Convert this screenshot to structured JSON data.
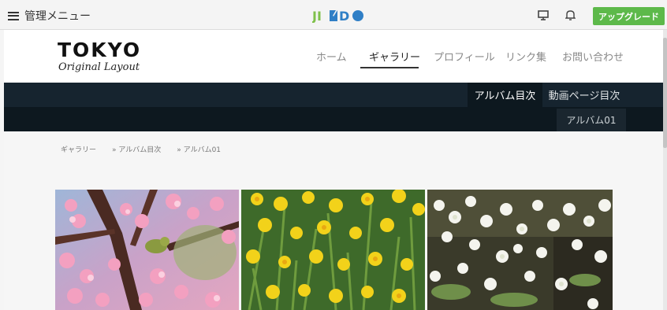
{
  "admin_bar": {
    "menu_label": "管理メニュー",
    "brand": {
      "letters": [
        "J",
        "I",
        "M",
        "D",
        "O"
      ],
      "colors": [
        "#7ec04a",
        "#7ec04a",
        "#2f7fc6",
        "#2f7fc6",
        "#2f7fc6"
      ]
    },
    "icons": [
      "monitor-icon",
      "bell-icon"
    ],
    "upgrade_label": "アップグレード",
    "upgrade_color": "#5db94a"
  },
  "site": {
    "logo_main": "TOKYO",
    "logo_sub": "Original Layout"
  },
  "nav": {
    "items": [
      {
        "label": "ホーム",
        "active": false
      },
      {
        "label": "ギャラリー",
        "active": true
      },
      {
        "label": "プロフィール",
        "active": false
      },
      {
        "label": "リンク集",
        "active": false
      },
      {
        "label": "お問い合わせ",
        "active": false
      }
    ]
  },
  "subnav": {
    "level1": [
      {
        "label": "アルバム目次",
        "active": true
      },
      {
        "label": "動画ページ目次",
        "active": false
      }
    ],
    "level2": [
      {
        "label": "アルバム01",
        "active": true
      }
    ]
  },
  "breadcrumb": {
    "items": [
      "ギャラリー",
      "» アルバム目次",
      "» アルバム01"
    ]
  },
  "gallery": {
    "photos": [
      "cherry-blossom-bird",
      "yellow-daffodils",
      "white-spirea-flowers"
    ]
  }
}
